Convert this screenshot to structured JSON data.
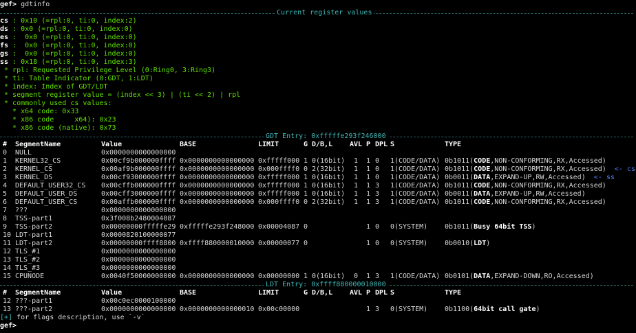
{
  "prompt": "gef>",
  "command": "gdtinfo",
  "current_section_title": "Current register values",
  "registers": [
    {
      "name": "cs",
      "val": " : 0x10 (=rpl:0, ti:0, index:2)"
    },
    {
      "name": "ds",
      "val": " : 0x0 (=rpl:0, ti:0, index:0)"
    },
    {
      "name": "es",
      "val": " :  0x0 (=rpl:0, ti:0, index:0)"
    },
    {
      "name": "fs",
      "val": " :  0x0 (=rpl:0, ti:0, index:0)"
    },
    {
      "name": "gs",
      "val": " :  0x0 (=rpl:0, ti:0, index:0)"
    },
    {
      "name": "ss",
      "val": " : 0x18 (=rpl:0, ti:0, index:3)"
    }
  ],
  "notes": [
    " * rpl: Requested Privilege Level (0:Ring0, 3:Ring3)",
    " * ti: Table Indicator (0:GDT, 1:LDT)",
    " * index: Index of GDT/LDT",
    " * segment register value = (index << 3) | (ti << 2) | rpl",
    " * commonly used cs values:",
    "   * x64 code: 0x33",
    "   * x86 code     x64): 0x23",
    "   * x86 code (native): 0x73"
  ],
  "gdt_section_title": "GDT Entry: 0xfffffe293f246000",
  "ldt_section_title": "LDT Entry: 0xffff880000010000",
  "headers": [
    "#",
    "SegmentName",
    "Value",
    "BASE",
    "LIMIT",
    "G",
    "D/B,L",
    "AVL",
    "P",
    "DPL",
    "S",
    "TYPE"
  ],
  "gdt_rows": [
    {
      "n": "0",
      "name": "NULL",
      "value": "0x0000000000000000"
    },
    {
      "n": "1",
      "name": "KERNEL32_CS",
      "value": "0x00cf9b000000ffff",
      "base": "0x0000000000000000",
      "limit": "0xfffff000",
      "g": "1",
      "db": "0(16bit)",
      "avl": "1",
      "p": "1",
      "dpl": "0",
      "s": "1(CODE/DATA)",
      "t0": "0b1011(",
      "tb": "CODE",
      "t1": ",NON-CONFORMING,RX,Accessed)"
    },
    {
      "n": "2",
      "name": "KERNEL_CS",
      "value": "0x00af9b000000ffff",
      "base": "0x0000000000000000",
      "limit": "0x000ffff0",
      "g": "0",
      "db": "2(32bit)",
      "avl": "1",
      "p": "1",
      "dpl": "0",
      "s": "1(CODE/DATA)",
      "t0": "0b1011(",
      "tb": "CODE",
      "t1": ",NON-CONFORMING,RX,Accessed)",
      "mark": "<- cs"
    },
    {
      "n": "3",
      "name": "KERNEL_DS",
      "value": "0x00cf93000000ffff",
      "base": "0x0000000000000000",
      "limit": "0xfffff000",
      "g": "1",
      "db": "0(16bit)",
      "avl": "1",
      "p": "1",
      "dpl": "0",
      "s": "1(CODE/DATA)",
      "t0": "0b0011(",
      "tb": "DATA",
      "t1": ",EXPAND-UP,RW,Accessed)",
      "mark": "<- ss"
    },
    {
      "n": "4",
      "name": "DEFAULT_USER32_CS",
      "value": "0x00cffb000000ffff",
      "base": "0x0000000000000000",
      "limit": "0xfffff000",
      "g": "1",
      "db": "0(16bit)",
      "avl": "1",
      "p": "1",
      "dpl": "3",
      "s": "1(CODE/DATA)",
      "t0": "0b1011(",
      "tb": "CODE",
      "t1": ",NON-CONFORMING,RX,Accessed)"
    },
    {
      "n": "5",
      "name": "DEFAULT_USER_DS",
      "value": "0x00cff3000000ffff",
      "base": "0x0000000000000000",
      "limit": "0xfffff000",
      "g": "1",
      "db": "0(16bit)",
      "avl": "1",
      "p": "1",
      "dpl": "3",
      "s": "1(CODE/DATA)",
      "t0": "0b0011(",
      "tb": "DATA",
      "t1": ",EXPAND-UP,RW,Accessed)"
    },
    {
      "n": "6",
      "name": "DEFAULT_USER_CS",
      "value": "0x00affb000000ffff",
      "base": "0x0000000000000000",
      "limit": "0x000ffff0",
      "g": "0",
      "db": "2(32bit)",
      "avl": "1",
      "p": "1",
      "dpl": "3",
      "s": "1(CODE/DATA)",
      "t0": "0b1011(",
      "tb": "CODE",
      "t1": ",NON-CONFORMING,RX,Accessed)"
    },
    {
      "n": "7",
      "name": "???",
      "value": "0x0000000000000000"
    },
    {
      "n": "8",
      "name": "TSS-part1",
      "value": "0x3f008b2480004087"
    },
    {
      "n": "9",
      "name": "TSS-part2",
      "value": "0x00000000fffffe29",
      "base": "0xfffffe293f248000",
      "limit": "0x00004087",
      "g": "0",
      "p": "1",
      "dpl": "0",
      "s": "0(SYSTEM)",
      "t0": "0b1011(",
      "tb": "Busy 64bit TSS",
      "t1": ")"
    },
    {
      "n": "10",
      "name": "LDT-part1",
      "value": "0x0000820100000077"
    },
    {
      "n": "11",
      "name": "LDT-part2",
      "value": "0x00000000ffff8800",
      "base": "0xffff880000010000",
      "limit": "0x00000077",
      "g": "0",
      "p": "1",
      "dpl": "0",
      "s": "0(SYSTEM)",
      "t0": "0b0010(",
      "tb": "LDT",
      "t1": ")"
    },
    {
      "n": "12",
      "name": "TLS_#1",
      "value": "0x0000000000000000"
    },
    {
      "n": "13",
      "name": "TLS_#2",
      "value": "0x0000000000000000"
    },
    {
      "n": "14",
      "name": "TLS_#3",
      "value": "0x0000000000000000"
    },
    {
      "n": "15",
      "name": "CPUNODE",
      "value": "0x0040f50000000000",
      "base": "0x0000000000000000",
      "limit": "0x00000000",
      "g": "1",
      "db": "0(16bit)",
      "avl": "0",
      "p": "1",
      "dpl": "3",
      "s": "1(CODE/DATA)",
      "t0": "0b0101(",
      "tb": "DATA",
      "t1": ",EXPAND-DOWN,RO,Accessed)"
    }
  ],
  "ldt_rows": [
    {
      "n": "12",
      "name": "???-part1",
      "value": "0x00c0ec0000100000"
    },
    {
      "n": "13",
      "name": "???-part2",
      "value": "0x0000000000000000",
      "base": "0x0000000000000010",
      "limit": "0x00c00000",
      "p": "1",
      "dpl": "3",
      "s": "0(SYSTEM)",
      "t0": "0b1100(",
      "tb": "64bit call gate",
      "t1": ")"
    }
  ],
  "footer_tag": "[+]",
  "footer_text": " for flags description, use `-v`",
  "colors": {
    "prompt": "#60e000",
    "section": "#40b8b8",
    "register": "#ff5050",
    "marker": "#5080ff"
  }
}
